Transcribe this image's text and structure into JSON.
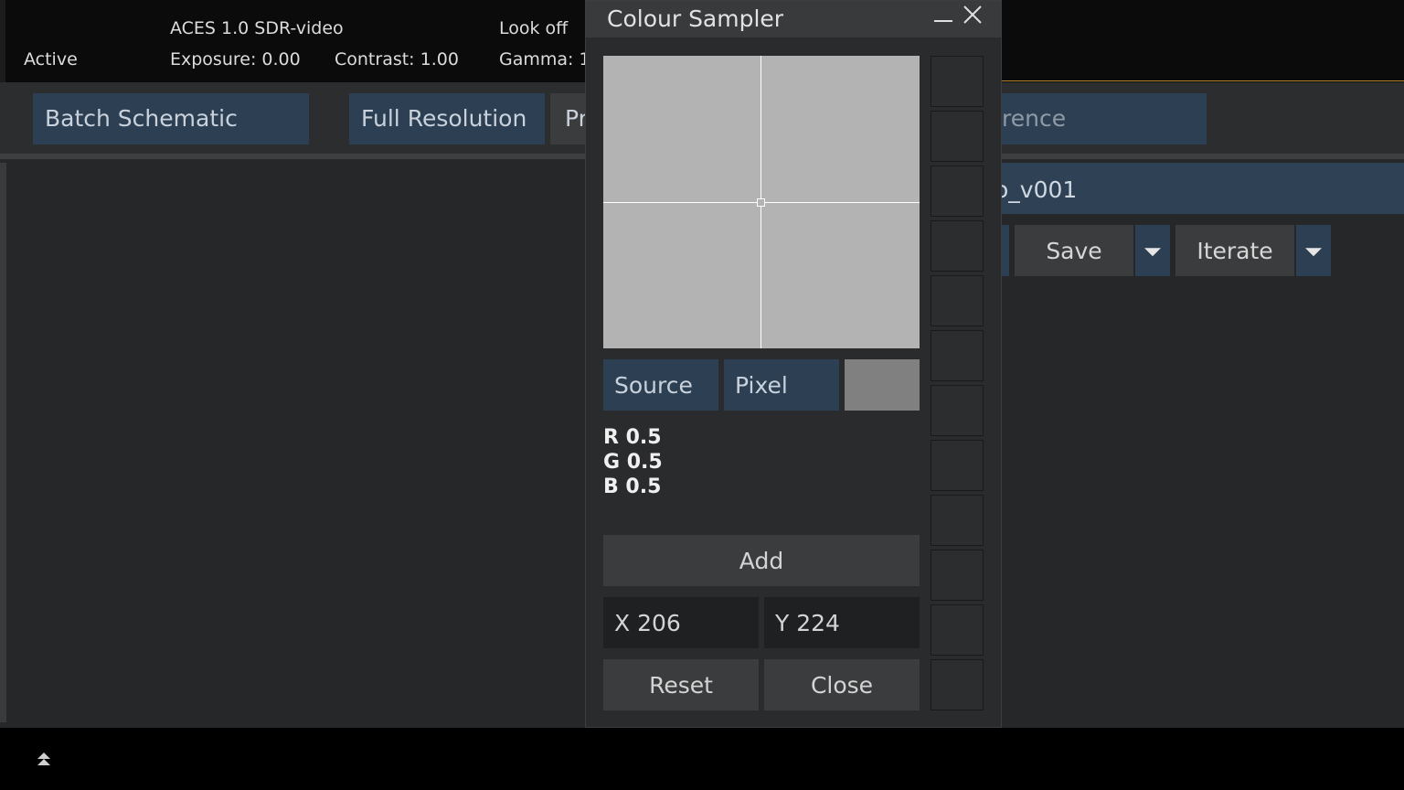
{
  "topbar": {
    "status": "Active",
    "colour_space": "ACES 1.0 SDR-video",
    "exposure": "Exposure: 0.00",
    "contrast": "Contrast: 1.00",
    "look": "Look off",
    "gamma": "Gamma: 1"
  },
  "toolbar": {
    "batch_schematic": "Batch Schematic",
    "full_resolution": "Full Resolution",
    "partial_button": "Pr",
    "reference_partial": "rence"
  },
  "right_panel": {
    "setup_name_partial": "o_v001",
    "save_label": "Save",
    "iterate_label": "Iterate"
  },
  "dialog": {
    "title": "Colour Sampler",
    "source_label": "Source",
    "pixel_label": "Pixel",
    "swatch_color": "#808080",
    "rgb": {
      "r": "R 0.5",
      "g": "G 0.5",
      "b": "B 0.5"
    },
    "add_label": "Add",
    "x_value": "X 206",
    "y_value": "Y 224",
    "reset_label": "Reset",
    "close_label": "Close",
    "slot_count": 12
  },
  "colors": {
    "button_blue": "#2d3f52",
    "button_grey": "#3b3c3d",
    "accent_line": "#b8872e",
    "preview_grey": "#b3b3b3"
  }
}
